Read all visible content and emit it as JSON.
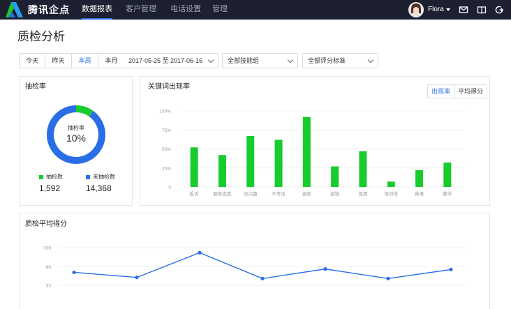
{
  "app": {
    "brand": "腾讯企点",
    "nav": [
      {
        "label": "数据报表",
        "active": true
      },
      {
        "label": "客户管理",
        "active": false
      },
      {
        "label": "电话设置",
        "active": false
      },
      {
        "label": "管理",
        "active": false
      }
    ],
    "user": {
      "name": "Flora"
    },
    "icons": [
      "mail-icon",
      "book-icon",
      "logout-icon"
    ],
    "colors": {
      "topbar": "#1c2030",
      "accent": "#2a6ee6",
      "green": "#17cc2c",
      "line_blue": "#2a6ee6"
    }
  },
  "page": {
    "title": "质检分析"
  },
  "filters": {
    "ranges": [
      {
        "label": "今天",
        "active": false
      },
      {
        "label": "昨天",
        "active": false
      },
      {
        "label": "本周",
        "active": true
      },
      {
        "label": "本月",
        "active": false
      }
    ],
    "date_range": "2017-05-25 至 2017-06-16",
    "skill_group": "全部技能组",
    "score_standard": "全部评分标准"
  },
  "sampling": {
    "title": "抽检率",
    "center_label": "抽检率",
    "center_value": "10%",
    "legend": [
      {
        "label": "抽检数",
        "value": "1,592",
        "color": "#17cc2c"
      },
      {
        "label": "未抽检数",
        "value": "14,368",
        "color": "#2a6ee6"
      }
    ]
  },
  "keyword_rate": {
    "title": "关键词出现率",
    "toggle": [
      {
        "label": "出现率",
        "active": true
      },
      {
        "label": "平均得分",
        "active": false
      }
    ]
  },
  "avg_score": {
    "title": "质检平均得分"
  },
  "chart_data": [
    {
      "type": "pie",
      "title": "抽检率",
      "categories": [
        "抽检数",
        "未抽检数"
      ],
      "values": [
        1592,
        14368
      ],
      "colors": [
        "#17cc2c",
        "#2a6ee6"
      ],
      "style": "donut"
    },
    {
      "type": "bar",
      "title": "关键词出现率",
      "categories": [
        "投诉",
        "服务态度",
        "没兴趣",
        "不考虑",
        "退款",
        "退钱",
        "免费",
        "培训班",
        "英语",
        "数学"
      ],
      "values": [
        52,
        42,
        67,
        62,
        92,
        27,
        47,
        7,
        22,
        32
      ],
      "ylim": [
        0,
        100
      ],
      "yticks": [
        "0",
        "25%",
        "50%",
        "75%",
        "100%"
      ],
      "grid": true,
      "color": "#17cc2c"
    },
    {
      "type": "line",
      "title": "质检平均得分",
      "x": [
        1,
        2,
        3,
        4,
        5,
        6,
        7
      ],
      "values": [
        56,
        47,
        91,
        45,
        62,
        45,
        61
      ],
      "ylim": [
        33,
        100
      ],
      "yticks": [
        "33",
        "66",
        "100"
      ],
      "grid": true,
      "color": "#2a6ee6"
    }
  ]
}
